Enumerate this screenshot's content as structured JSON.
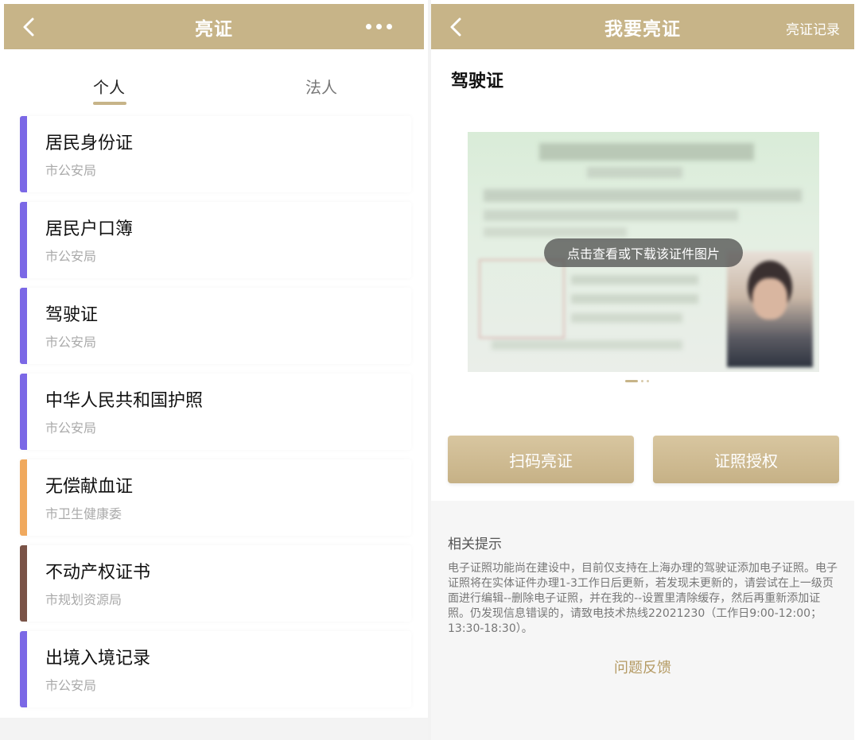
{
  "left": {
    "header": {
      "title": "亮证"
    },
    "tabs": [
      {
        "label": "个人"
      },
      {
        "label": "法人"
      }
    ],
    "certs": [
      {
        "name": "居民身份证",
        "issuer": "市公安局",
        "color": "#7b68e6"
      },
      {
        "name": "居民户口簿",
        "issuer": "市公安局",
        "color": "#7b68e6"
      },
      {
        "name": "驾驶证",
        "issuer": "市公安局",
        "color": "#7b68e6"
      },
      {
        "name": "中华人民共和国护照",
        "issuer": "市公安局",
        "color": "#7b68e6"
      },
      {
        "name": "无偿献血证",
        "issuer": "市卫生健康委",
        "color": "#f0a95e"
      },
      {
        "name": "不动产权证书",
        "issuer": "市规划资源局",
        "color": "#7a5347"
      },
      {
        "name": "出境入境记录",
        "issuer": "市公安局",
        "color": "#7b68e6"
      }
    ]
  },
  "right": {
    "header": {
      "title": "我要亮证",
      "record_link": "亮证记录"
    },
    "cert_title": "驾驶证",
    "image_overlay": "点击查看或下载该证件图片",
    "buttons": {
      "scan": "扫码亮证",
      "authorize": "证照授权"
    },
    "tips": {
      "title": "相关提示",
      "body": "电子证照功能尚在建设中，目前仅支持在上海办理的驾驶证添加电子证照。电子证照将在实体证件办理1-3工作日后更新，若发现未更新的，请尝试在上一级页面进行编辑--删除电子证照，并在我的--设置里清除缓存，然后再重新添加证照。仍发现信息错误的，请致电技术热线22021230（工作日9:00-12:00；13:30-18:30）。",
      "feedback": "问题反馈"
    }
  },
  "colors": {
    "accent": "#c7b488",
    "accent_text": "#b49a63"
  }
}
